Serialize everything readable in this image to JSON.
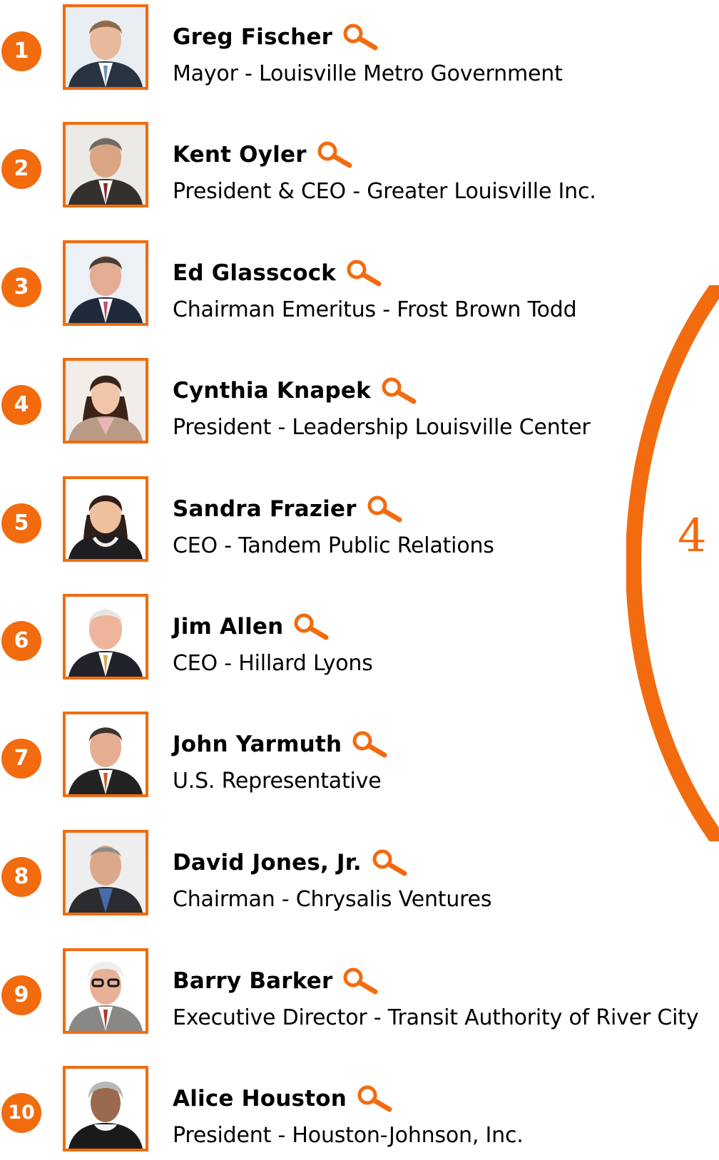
{
  "colors": {
    "accent": "#f26b0f",
    "text": "#000000",
    "background": "#ffffff"
  },
  "people": [
    {
      "rank": "1",
      "name": "Greg Fischer",
      "title": "Mayor - Louisville Metro Government",
      "icon": "magnifier-icon"
    },
    {
      "rank": "2",
      "name": "Kent Oyler",
      "title": "President & CEO - Greater Louisville Inc.",
      "icon": "magnifier-icon"
    },
    {
      "rank": "3",
      "name": "Ed Glasscock",
      "title": "Chairman Emeritus - Frost Brown Todd",
      "icon": "magnifier-icon"
    },
    {
      "rank": "4",
      "name": "Cynthia Knapek",
      "title": "President - Leadership Louisville Center",
      "icon": "magnifier-icon"
    },
    {
      "rank": "5",
      "name": "Sandra Frazier",
      "title": "CEO - Tandem Public Relations",
      "icon": "magnifier-icon"
    },
    {
      "rank": "6",
      "name": "Jim Allen",
      "title": "CEO - Hillard Lyons",
      "icon": "magnifier-icon"
    },
    {
      "rank": "7",
      "name": "John Yarmuth",
      "title": "U.S. Representative",
      "icon": "magnifier-icon"
    },
    {
      "rank": "8",
      "name": "David Jones, Jr.",
      "title": "Chairman - Chrysalis Ventures",
      "icon": "magnifier-icon"
    },
    {
      "rank": "9",
      "name": "Barry Barker",
      "title": "Executive Director - Transit Authority of River City",
      "icon": "magnifier-icon"
    },
    {
      "rank": "10",
      "name": "Alice Houston",
      "title": "President - Houston-Johnson, Inc.",
      "icon": "magnifier-icon"
    }
  ],
  "side_graphic": {
    "number": "4"
  }
}
